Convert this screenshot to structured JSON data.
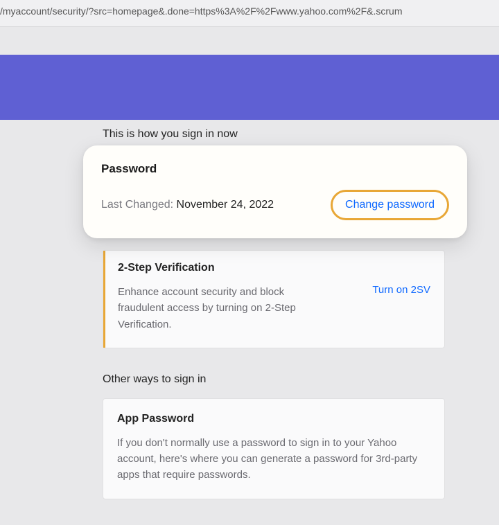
{
  "url": "/myaccount/security/?src=homepage&.done=https%3A%2F%2Fwww.yahoo.com%2F&.scrum",
  "section1_heading": "This is how you sign in now",
  "password_card": {
    "title": "Password",
    "last_changed_label": "Last Changed:",
    "last_changed_value": "November 24, 2022",
    "action": "Change password"
  },
  "twosv_card": {
    "title": "2-Step Verification",
    "desc": "Enhance account security and block fraudulent access by turning on 2-Step Verification.",
    "action": "Turn on 2SV"
  },
  "section2_heading": "Other ways to sign in",
  "apppw_card": {
    "title": "App Password",
    "desc": "If you don't normally use a password to sign in to your Yahoo account, here's where you can generate a password for 3rd-party apps that require passwords."
  }
}
